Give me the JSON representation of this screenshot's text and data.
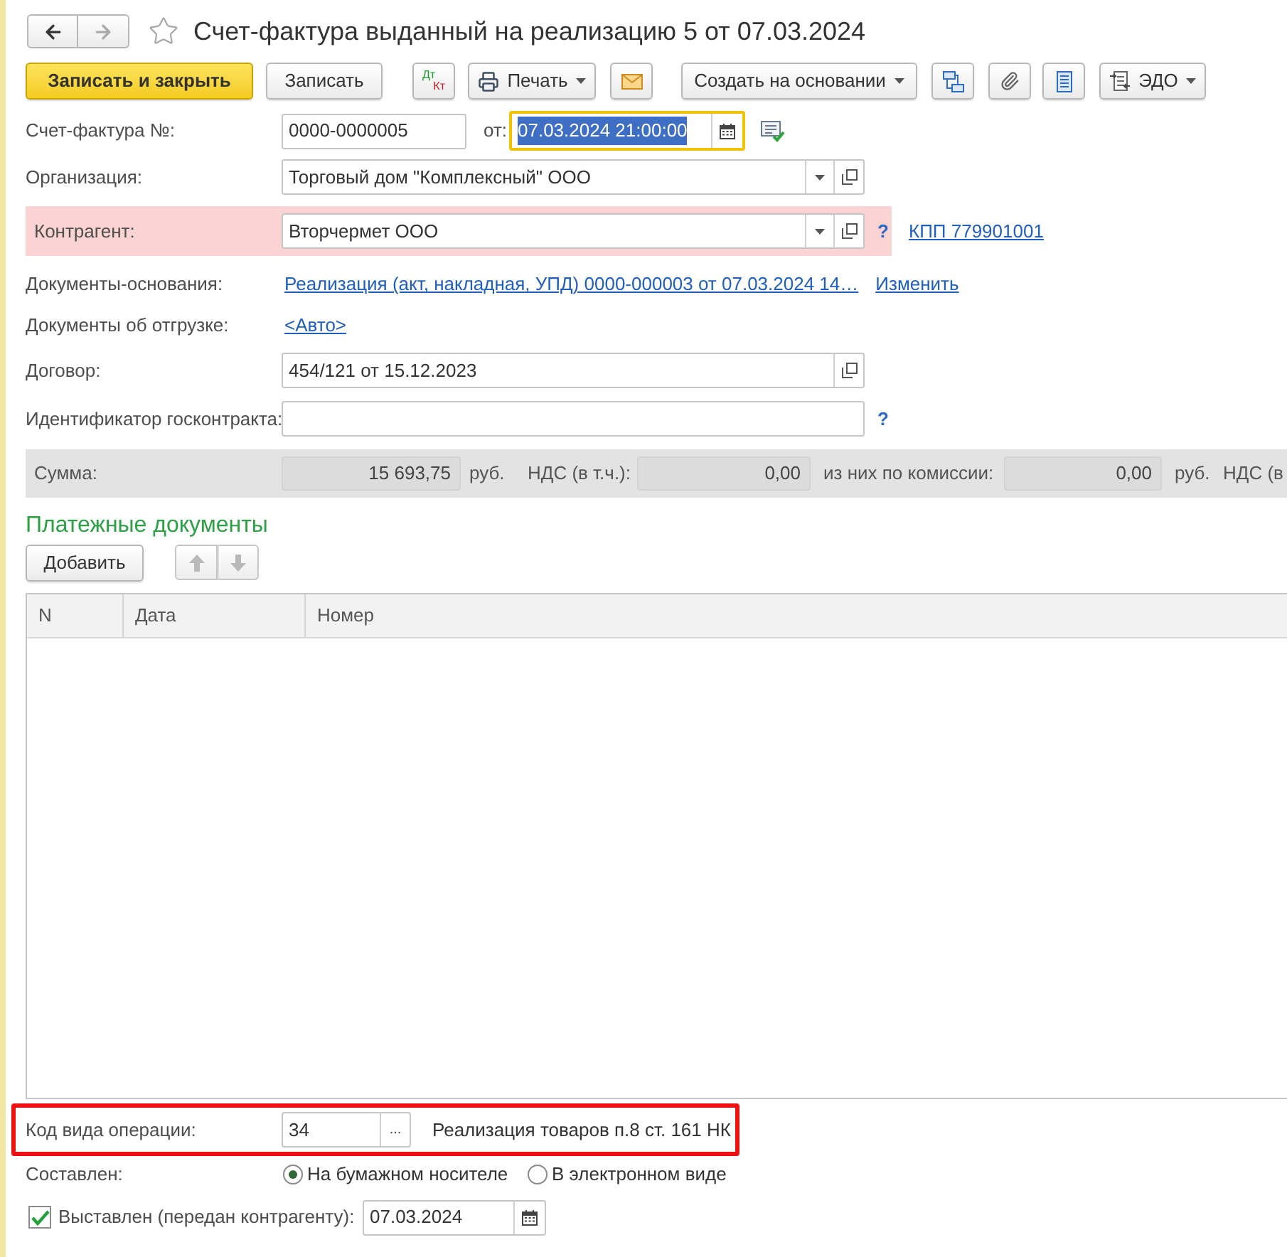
{
  "window": {
    "title": "Счет-фактура выданный на реализацию 5 от 07.03.2024",
    "favorite": false
  },
  "nav": {
    "back": {
      "disabled": false
    },
    "forward": {
      "disabled": true
    }
  },
  "toolbar": {
    "save_and_close": "Записать и закрыть",
    "save": "Записать",
    "debit_credit": {
      "top": "Дт",
      "bottom": "Кт"
    },
    "print": "Печать",
    "create_based_on": "Создать на основании",
    "edo": "ЭДО"
  },
  "header": {
    "invoice_number": {
      "label": "Счет-фактура №:",
      "value": "0000-0000005"
    },
    "date": {
      "label": "от:",
      "value": "07.03.2024 21:00:00",
      "focused": true
    },
    "organization": {
      "label": "Организация:",
      "value": "Торговый дом \"Комплексный\" ООО"
    },
    "counterparty": {
      "label": "Контрагент:",
      "value": "Вторчермет ООО",
      "highlighted": true,
      "help": "?",
      "kpp_link": "КПП 779901001"
    },
    "base_documents": {
      "label": "Документы-основания:",
      "link": "Реализация (акт, накладная, УПД) 0000-000003 от 07.03.2024 14…",
      "change_link": "Изменить"
    },
    "shipping_documents": {
      "label": "Документы об отгрузке:",
      "link": "<Авто>"
    },
    "contract": {
      "label": "Договор:",
      "value": "454/121 от 15.12.2023"
    },
    "gov_contract_id": {
      "label": "Идентификатор госконтракта:",
      "help": "?"
    }
  },
  "totals": [
    {
      "kind": "label",
      "text": "Сумма:"
    },
    {
      "kind": "field",
      "value": "15 693,75"
    },
    {
      "kind": "label",
      "text": "руб."
    },
    {
      "kind": "label",
      "text": "НДС (в т.ч.):"
    },
    {
      "kind": "field",
      "value": "0,00"
    },
    {
      "kind": "label",
      "text": "из них по комиссии:"
    },
    {
      "kind": "field",
      "value": "0,00"
    },
    {
      "kind": "label",
      "text": "руб."
    },
    {
      "kind": "label",
      "text": "НДС (в"
    }
  ],
  "payment_documents": {
    "title": "Платежные документы",
    "add_button": "Добавить",
    "move_up": {
      "disabled": true
    },
    "move_down": {
      "disabled": true
    },
    "columns": [
      "N",
      "Дата",
      "Номер"
    ]
  },
  "operation_code": {
    "label": "Код вида операции:",
    "value": "34",
    "select_button": "...",
    "description": "Реализация товаров п.8 ст. 161 НК",
    "highlighted": true
  },
  "compiled": {
    "label": "Составлен:",
    "options": [
      {
        "label": "На бумажном носителе",
        "selected": true
      },
      {
        "label": "В электронном виде",
        "selected": false
      }
    ]
  },
  "issued": {
    "label": "Выставлен (передан контрагенту):",
    "checked": true,
    "date": "07.03.2024"
  }
}
